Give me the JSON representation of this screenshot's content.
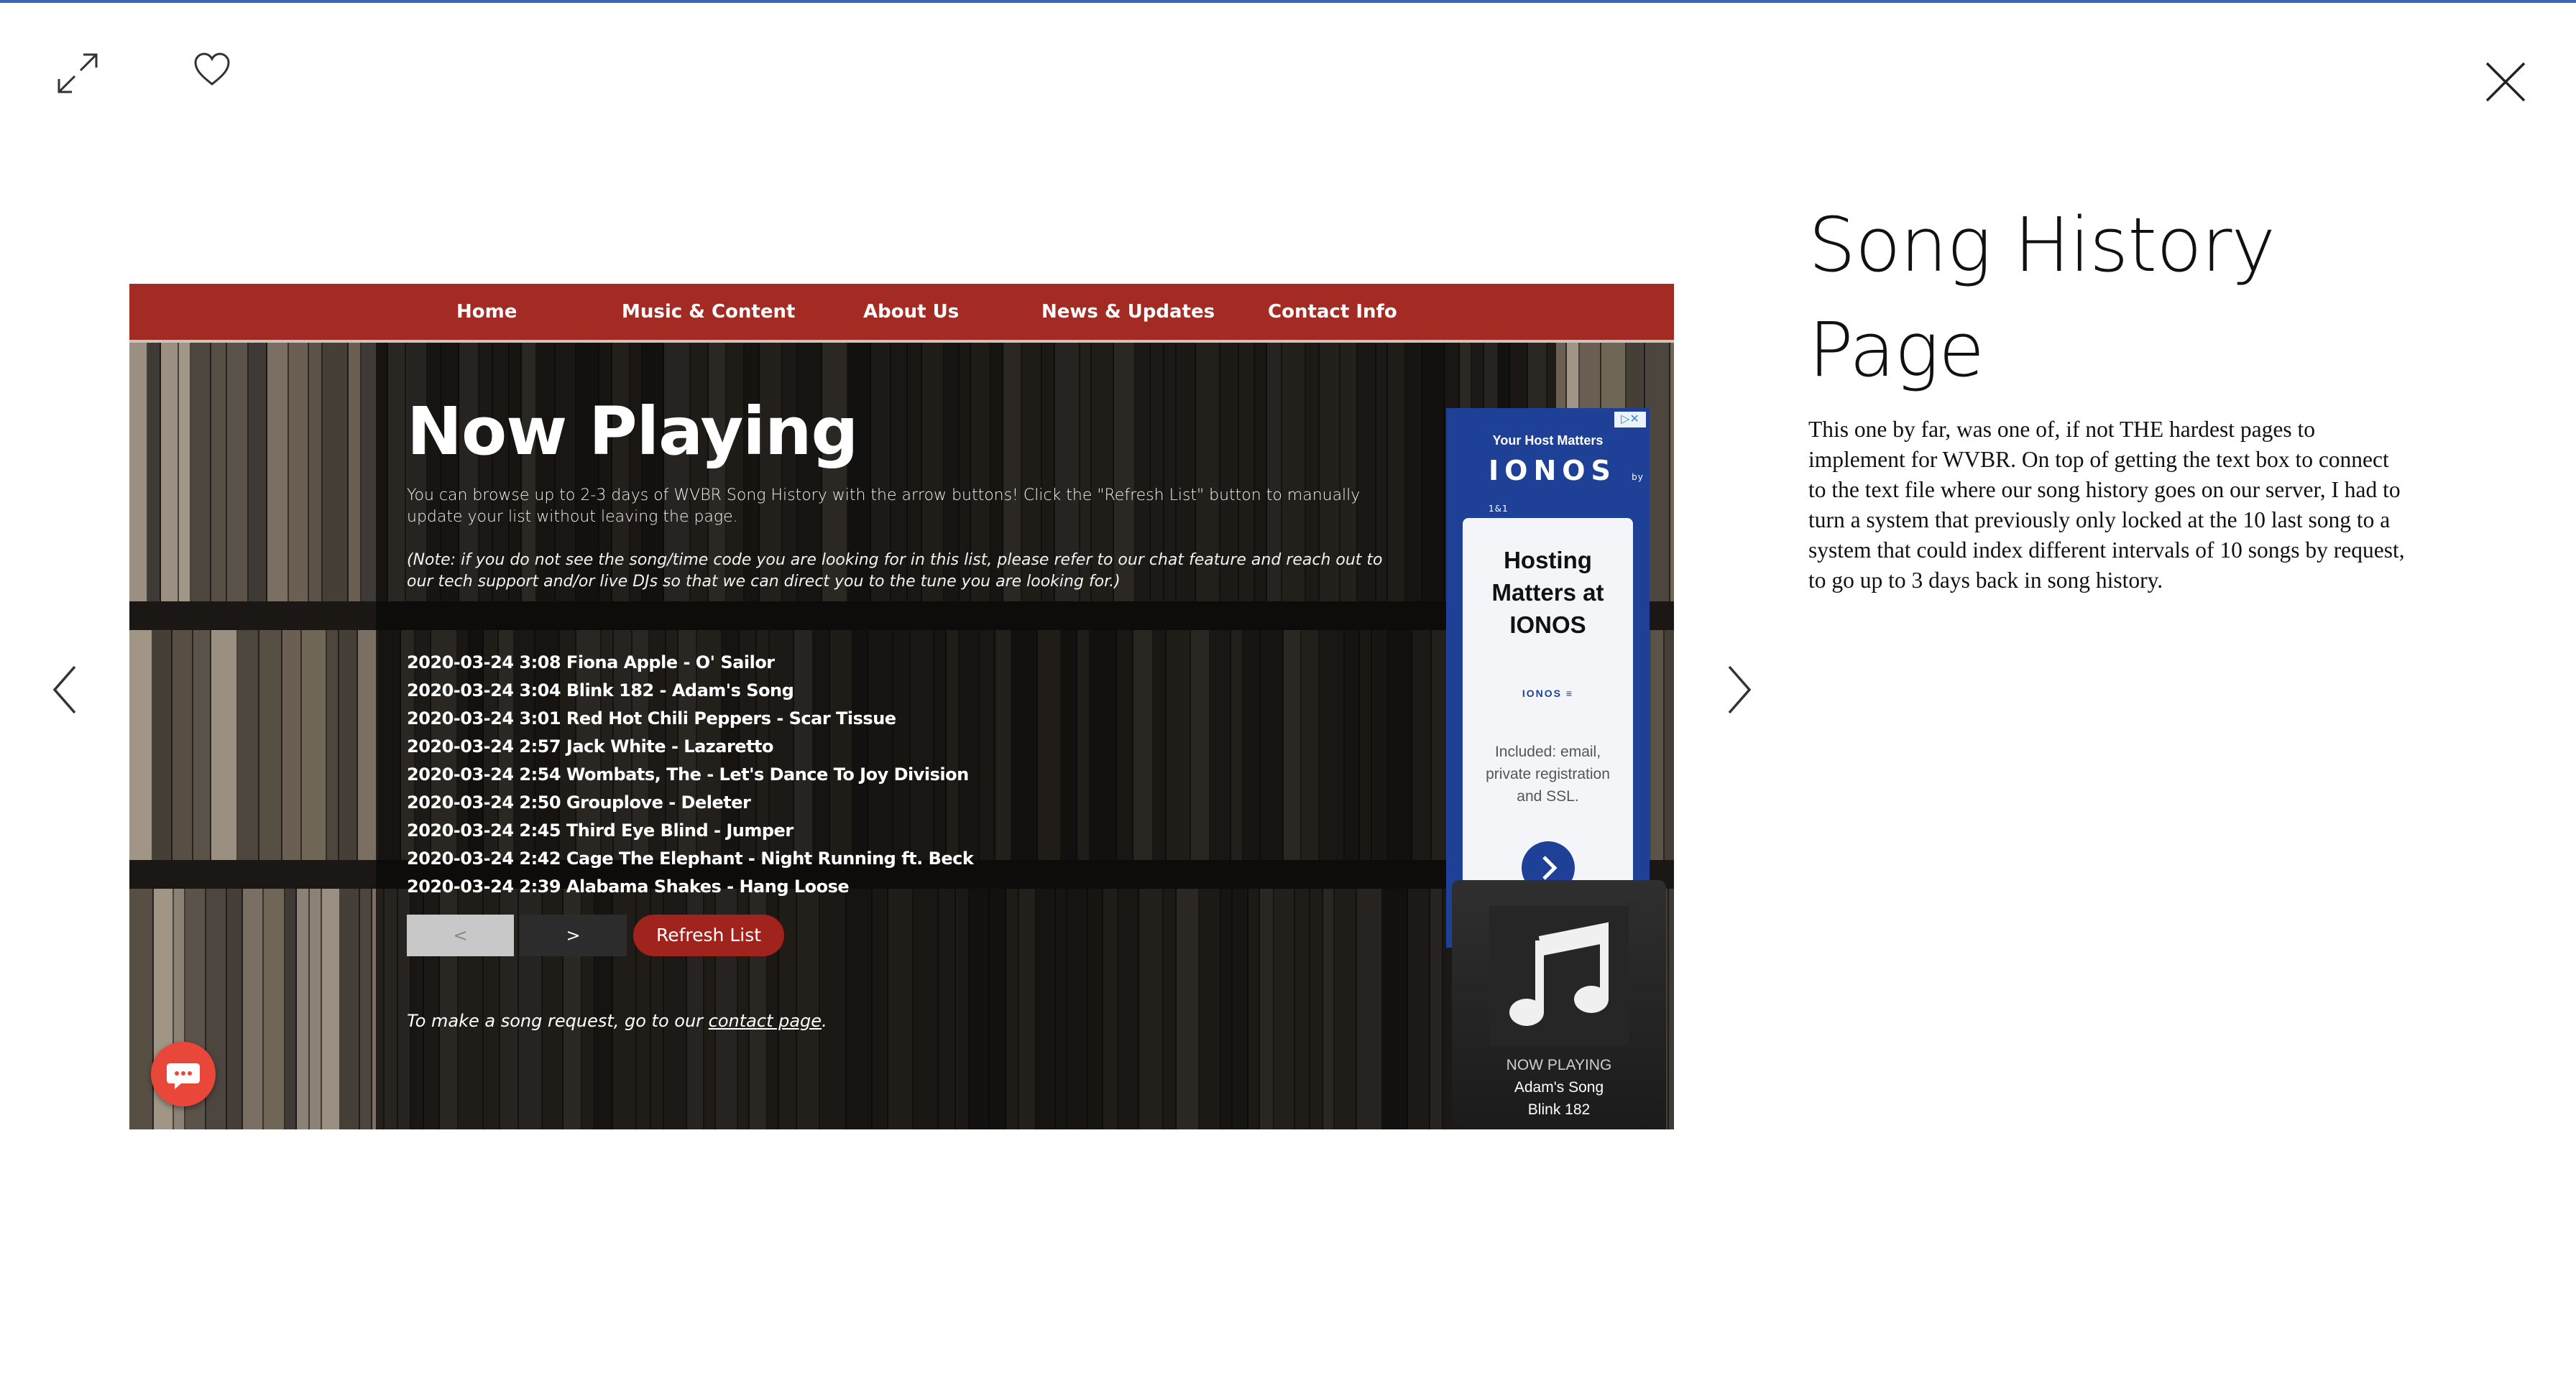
{
  "lightbox": {
    "expand_icon": "expand-icon",
    "like_icon": "heart-icon",
    "close_icon": "close-icon",
    "prev_icon": "chevron-left-icon",
    "next_icon": "chevron-right-icon"
  },
  "screenshot": {
    "nav": [
      "Home",
      "Music & Content",
      "About Us",
      "News & Updates",
      "Contact Info"
    ],
    "title": "Now Playing",
    "intro": "You can browse up to 2-3 days of WVBR Song History with the arrow buttons! Click the \"Refresh List\" button to manually update your list without leaving the page.",
    "note": "(Note: if you do not see the song/time code you are looking for in this list, please refer to our chat feature and reach out to our tech support and/or live DJs so that we can direct you to the tune you are looking for.)",
    "songs": [
      "2020-03-24 3:08 Fiona Apple - O' Sailor",
      "2020-03-24 3:04 Blink 182 - Adam's Song",
      "2020-03-24 3:01 Red Hot Chili Peppers - Scar Tissue",
      "2020-03-24 2:57 Jack White - Lazaretto",
      "2020-03-24 2:54 Wombats, The - Let's Dance To Joy Division",
      "2020-03-24 2:50 Grouplove - Deleter",
      "2020-03-24 2:45 Third Eye Blind - Jumper",
      "2020-03-24 2:42 Cage The Elephant - Night Running ft. Beck",
      "2020-03-24 2:39 Alabama Shakes - Hang Loose"
    ],
    "buttons": {
      "prev": "<",
      "next": ">",
      "refresh": "Refresh List"
    },
    "request": {
      "before": "To make a song request, go to our ",
      "link": "contact page",
      "after": "."
    },
    "ad": {
      "top": "Your Host Matters",
      "logo": "IONOS",
      "logo_sub": "by 1&1",
      "headline": "Hosting Matters at IONOS",
      "small_logo": "IONOS ≡",
      "body": "Included: email, private registration and SSL."
    },
    "now_playing": {
      "label": "NOW PLAYING",
      "song": "Adam's Song",
      "artist": "Blink 182"
    },
    "chat_icon": "chat-icon",
    "colors": {
      "nav": "#a42a24",
      "refresh": "#a0231d",
      "ad": "#1e4096",
      "chat": "#e8473a"
    }
  },
  "sidebar": {
    "title": "Song History Page",
    "body": "This one by far, was one of, if not THE hardest pages to implement for WVBR. On top of getting the text box to connect to the text file where our song history goes on our server, I had to turn a system that previously only locked at the 10 last song to a system that could index different intervals of 10 songs by request, to go up to 3 days back in song history."
  }
}
